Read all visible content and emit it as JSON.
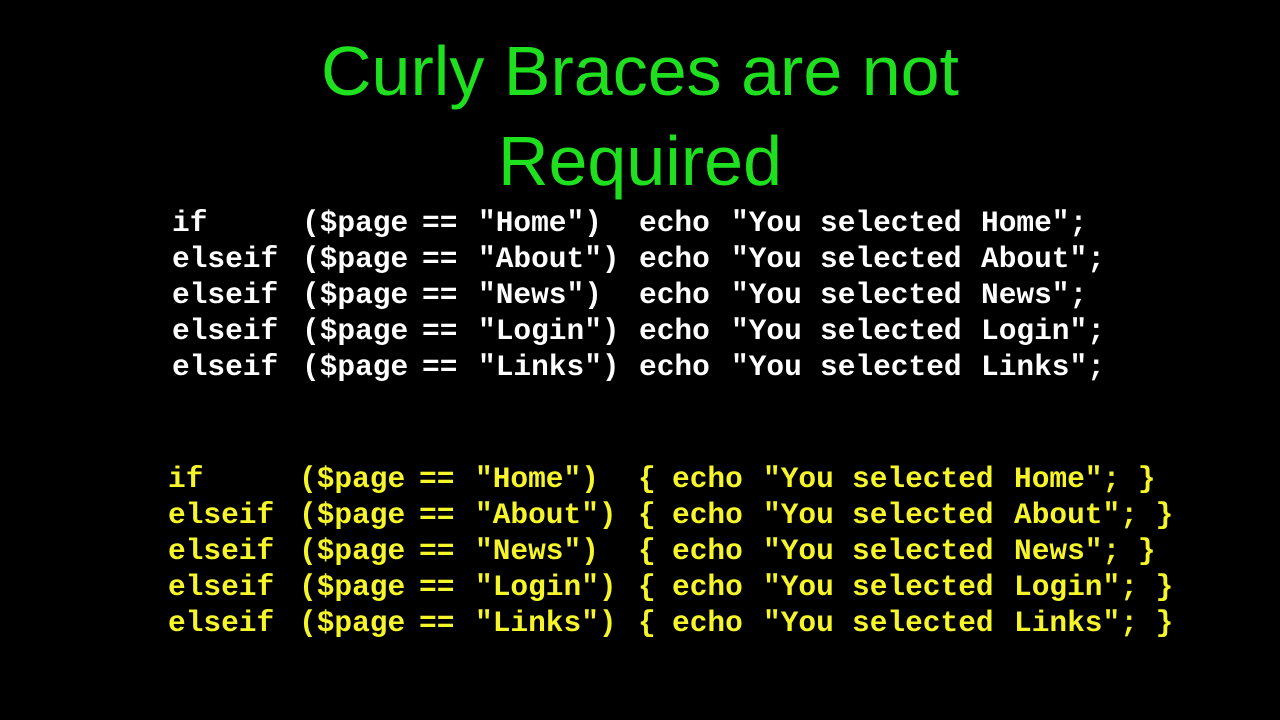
{
  "slide": {
    "title_line1": "Curly Braces are not",
    "title_line2": "Required",
    "colors": {
      "background": "#000000",
      "title": "#1fe01f",
      "code_without_braces": "#ffffff",
      "code_with_braces": "#f5f52a"
    }
  },
  "without_braces": [
    {
      "kw": "if",
      "var": "($page",
      "op": "==",
      "cond": "\"Home\")",
      "echo": "echo",
      "s1": "\"You",
      "s2": "selected",
      "s3": "Home\";"
    },
    {
      "kw": "elseif",
      "var": "($page",
      "op": "==",
      "cond": "\"About\")",
      "echo": "echo",
      "s1": "\"You",
      "s2": "selected",
      "s3": "About\";"
    },
    {
      "kw": "elseif",
      "var": "($page",
      "op": "==",
      "cond": "\"News\")",
      "echo": "echo",
      "s1": "\"You",
      "s2": "selected",
      "s3": "News\";"
    },
    {
      "kw": "elseif",
      "var": "($page",
      "op": "==",
      "cond": "\"Login\")",
      "echo": "echo",
      "s1": "\"You",
      "s2": "selected",
      "s3": "Login\";"
    },
    {
      "kw": "elseif",
      "var": "($page",
      "op": "==",
      "cond": "\"Links\")",
      "echo": "echo",
      "s1": "\"You",
      "s2": "selected",
      "s3": "Links\";"
    }
  ],
  "with_braces": [
    {
      "kw": "if",
      "var": "($page",
      "op": "==",
      "cond": "\"Home\")",
      "open": "{",
      "echo": "echo",
      "s1": "\"You",
      "s2": "selected",
      "s3": "Home\"; }"
    },
    {
      "kw": "elseif",
      "var": "($page",
      "op": "==",
      "cond": "\"About\")",
      "open": "{",
      "echo": "echo",
      "s1": "\"You",
      "s2": "selected",
      "s3": "About\"; }"
    },
    {
      "kw": "elseif",
      "var": "($page",
      "op": "==",
      "cond": "\"News\")",
      "open": "{",
      "echo": "echo",
      "s1": "\"You",
      "s2": "selected",
      "s3": "News\"; }"
    },
    {
      "kw": "elseif",
      "var": "($page",
      "op": "==",
      "cond": "\"Login\")",
      "open": "{",
      "echo": "echo",
      "s1": "\"You",
      "s2": "selected",
      "s3": "Login\"; }"
    },
    {
      "kw": "elseif",
      "var": "($page",
      "op": "==",
      "cond": "\"Links\")",
      "open": "{",
      "echo": "echo",
      "s1": "\"You",
      "s2": "selected",
      "s3": "Links\"; }"
    }
  ]
}
